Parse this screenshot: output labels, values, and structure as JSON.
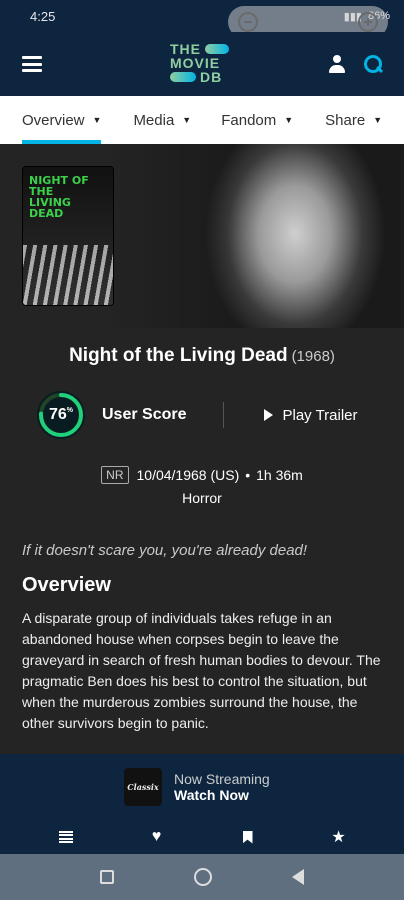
{
  "status_bar": {
    "time": "4:25",
    "battery": "86%"
  },
  "header": {
    "logo_line1": "THE",
    "logo_line2": "MOVIE",
    "logo_line3": "DB"
  },
  "tabs": [
    {
      "label": "Overview",
      "active": true
    },
    {
      "label": "Media",
      "active": false
    },
    {
      "label": "Fandom",
      "active": false
    },
    {
      "label": "Share",
      "active": false
    }
  ],
  "poster": {
    "title_text": "NIGHT OF THE LIVING DEAD"
  },
  "movie": {
    "title": "Night of the Living Dead",
    "year": "(1968)",
    "user_score": "76",
    "user_score_percent_sign": "%",
    "user_score_fraction": 0.76,
    "user_score_label": "User Score",
    "play_trailer": "Play Trailer",
    "certification": "NR",
    "release": "10/04/1968 (US)",
    "separator": "•",
    "runtime": "1h 36m",
    "genre": "Horror",
    "tagline": "If it doesn't scare you, you're already dead!",
    "overview_heading": "Overview",
    "overview": "A disparate group of individuals takes refuge in an abandoned house when corpses begin to leave the graveyard in search of fresh human bodies to devour. The pragmatic Ben does his best to control the situation, but when the murderous zombies surround the house, the other survivors begin to panic."
  },
  "streaming": {
    "provider": "Classix",
    "line1": "Now Streaming",
    "line2": "Watch Now"
  },
  "colors": {
    "header": "#0d253f",
    "accent": "#01b4e4",
    "score_ring": "#21d07a",
    "background": "#242424"
  },
  "bottom_nav": [
    "list-icon",
    "heart-icon",
    "bookmark-icon",
    "star-icon"
  ],
  "system_nav": [
    "recents-icon",
    "home-icon",
    "back-icon"
  ]
}
